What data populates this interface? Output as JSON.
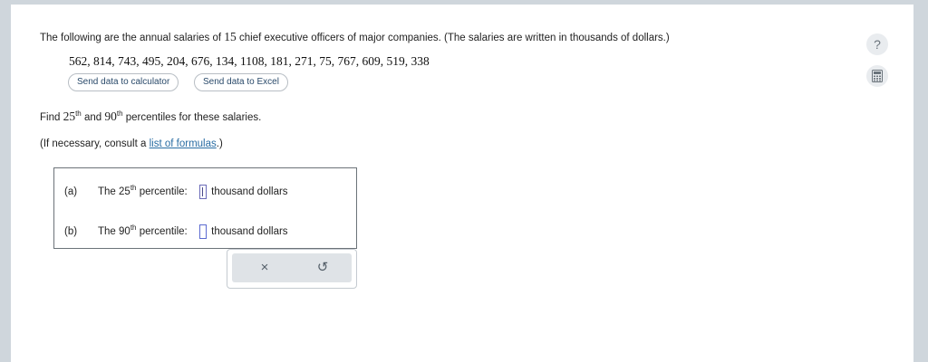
{
  "question": {
    "text_start": "The following are the annual salaries of",
    "count": "15",
    "text_end": "chief executive officers of major companies. (The salaries are written in thousands of dollars.)"
  },
  "data_values": "562, 814, 743, 495, 204, 676, 134, 1108, 181, 271, 75, 767, 609, 519, 338",
  "buttons": {
    "calculator": "Send data to calculator",
    "excel": "Send data to Excel"
  },
  "find": {
    "prefix": "Find",
    "p1": "25",
    "p1_sup": "th",
    "and": "and",
    "p2": "90",
    "p2_sup": "th",
    "suffix": "percentiles for these salaries."
  },
  "consult": {
    "prefix": "(If necessary, consult a",
    "link": "list of formulas",
    "suffix": ".)"
  },
  "answers": {
    "a": {
      "label": "(a)",
      "text": "The 25",
      "sup": "th",
      "after": "percentile:",
      "unit": "thousand dollars",
      "value": ""
    },
    "b": {
      "label": "(b)",
      "text": "The 90",
      "sup": "th",
      "after": "percentile:",
      "unit": "thousand dollars",
      "value": ""
    }
  },
  "tools": {
    "clear_icon": "×",
    "undo_icon": "↺"
  },
  "side": {
    "help_icon": "?",
    "calculator_icon": "calculator-icon"
  }
}
